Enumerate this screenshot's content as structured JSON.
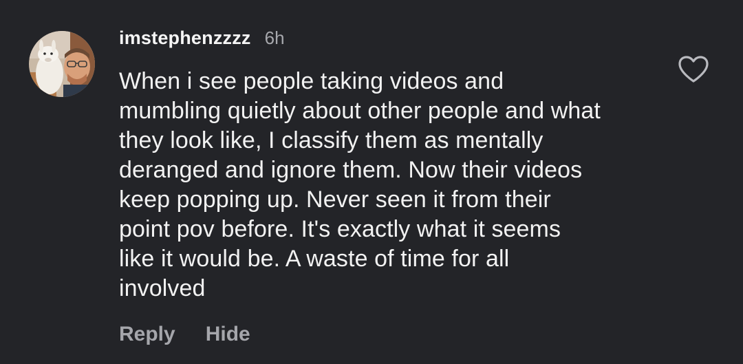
{
  "comment": {
    "username": "imstephenzzzz",
    "timestamp": "6h",
    "text": "When i see people taking videos and\nmumbling quietly about other people and what\nthey look like, I classify them as mentally\nderanged and ignore them. Now their videos\nkeep popping up. Never seen it from their\npoint pov before. It's exactly what it seems\nlike it would be. A waste of time for all\ninvolved",
    "actions": {
      "reply_label": "Reply",
      "hide_label": "Hide"
    },
    "avatar_icon": "user-avatar-with-llama",
    "like_icon": "heart-outline-icon"
  },
  "colors": {
    "background": "#232428",
    "text_primary": "#f2f2f2",
    "text_secondary": "#a7a8ad"
  }
}
